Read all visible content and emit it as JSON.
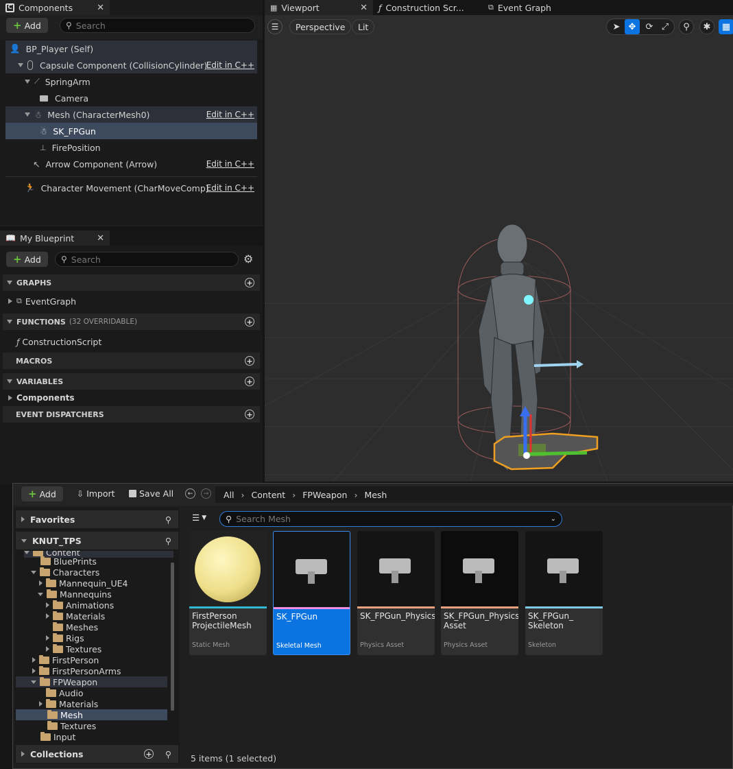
{
  "components_panel": {
    "title": "Components",
    "add_label": "Add",
    "search_placeholder": "Search",
    "tree": [
      {
        "label": "BP_Player (Self)",
        "edit": ""
      },
      {
        "label": "Capsule Component (CollisionCylinder)",
        "edit": "Edit in C++"
      },
      {
        "label": "SpringArm",
        "edit": ""
      },
      {
        "label": "Camera",
        "edit": ""
      },
      {
        "label": "Mesh (CharacterMesh0)",
        "edit": "Edit in C++"
      },
      {
        "label": "SK_FPGun",
        "edit": ""
      },
      {
        "label": "FirePosition",
        "edit": ""
      },
      {
        "label": "Arrow Component (Arrow)",
        "edit": "Edit in C++"
      },
      {
        "label": "Character Movement (CharMoveComp)",
        "edit": "Edit in C++"
      }
    ]
  },
  "my_blueprint": {
    "title": "My Blueprint",
    "add_label": "Add",
    "search_placeholder": "Search",
    "sections": {
      "graphs": "GRAPHS",
      "eventgraph": "EventGraph",
      "functions": "FUNCTIONS",
      "functions_note": "(32 OVERRIDABLE)",
      "construction": "ConstructionScript",
      "macros": "MACROS",
      "variables": "VARIABLES",
      "components": "Components",
      "dispatchers": "EVENT DISPATCHERS"
    }
  },
  "editor_tabs": {
    "viewport": "Viewport",
    "construction": "Construction Scr...",
    "event_graph": "Event Graph"
  },
  "viewport": {
    "perspective": "Perspective",
    "lit": "Lit"
  },
  "content_browser": {
    "add_label": "Add",
    "import_label": "Import",
    "save_all_label": "Save All",
    "breadcrumb": [
      "All",
      "Content",
      "FPWeapon",
      "Mesh"
    ],
    "favorites": "Favorites",
    "project": "KNUT_TPS",
    "collections": "Collections",
    "search_placeholder": "Search Mesh",
    "status": "5 items (1 selected)",
    "tree": [
      "Content",
      "BluePrints",
      "Characters",
      "Mannequin_UE4",
      "Mannequins",
      "Animations",
      "Materials",
      "Meshes",
      "Rigs",
      "Textures",
      "FirstPerson",
      "FirstPersonArms",
      "FPWeapon",
      "Audio",
      "Materials",
      "Mesh",
      "Textures",
      "Input"
    ],
    "assets": [
      {
        "name": "FirstPerson ProjectileMesh",
        "type": "Static Mesh",
        "color": "#2fb8d2"
      },
      {
        "name": "SK_FPGun",
        "type": "Skeletal Mesh",
        "color": "#ef8ee6"
      },
      {
        "name": "SK_FPGun_Physics",
        "type": "Physics Asset",
        "color": "#e8a27c"
      },
      {
        "name": "SK_FPGun_Physics Asset",
        "type": "Physics Asset",
        "color": "#e8a27c"
      },
      {
        "name": "SK_FPGun_ Skeleton",
        "type": "Skeleton",
        "color": "#7ec9e6"
      }
    ]
  }
}
